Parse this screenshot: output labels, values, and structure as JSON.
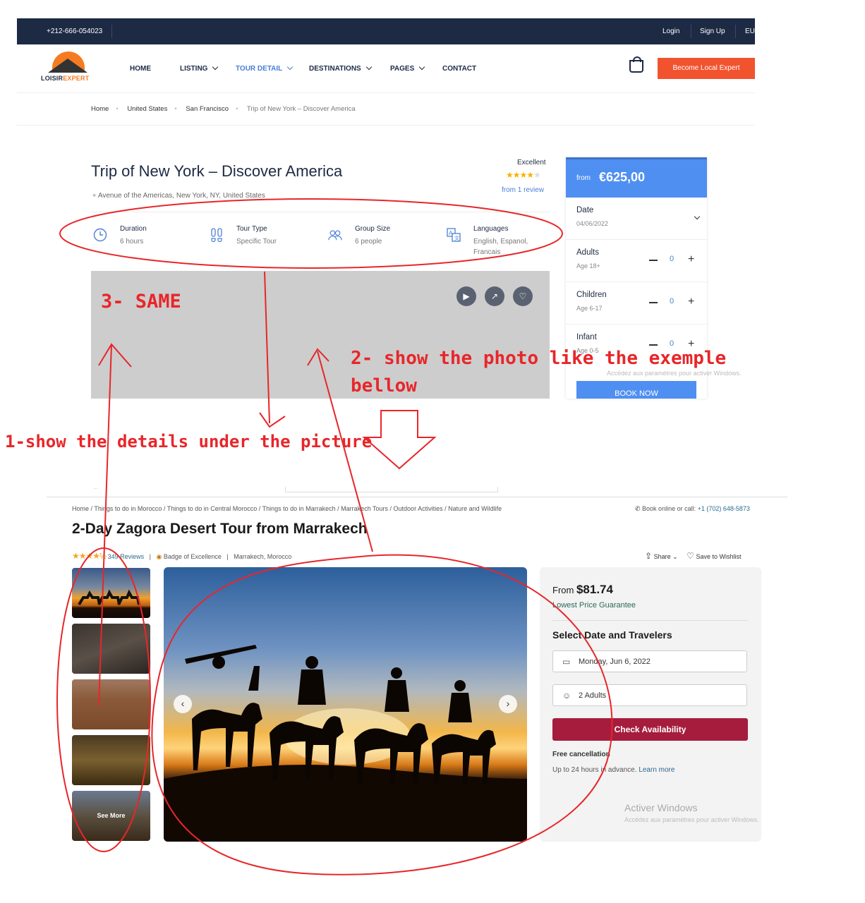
{
  "topbar": {
    "phone": "+212-666-054023",
    "login": "Login",
    "signup": "Sign Up",
    "currency": "EU"
  },
  "logo": {
    "part1": "LOISIR",
    "part2": "EXPERT"
  },
  "nav": {
    "items": [
      "HOME",
      "LISTING",
      "TOUR DETAIL",
      "DESTINATIONS",
      "PAGES",
      "CONTACT"
    ],
    "become_expert": "Become Local Expert"
  },
  "breadcrumb": [
    "Home",
    "United States",
    "San Francisco",
    "Trip of New York – Discover America"
  ],
  "tour": {
    "title": "Trip of New York – Discover America",
    "address": "Avenue of the Americas, New York, NY, United States",
    "rating_label": "Excellent",
    "rating_stars": 4,
    "reviews": "from 1 review",
    "features": [
      {
        "label": "Duration",
        "value": "6 hours",
        "icon": "clock-icon"
      },
      {
        "label": "Tour Type",
        "value": "Specific Tour",
        "icon": "footprints-icon"
      },
      {
        "label": "Group Size",
        "value": "6 people",
        "icon": "people-icon"
      },
      {
        "label": "Languages",
        "value": "English, Espanol, Francais",
        "icon": "translate-icon"
      }
    ]
  },
  "booking": {
    "from": "from",
    "price": "€625,00",
    "date_label": "Date",
    "date_value": "04/06/2022",
    "rows": [
      {
        "label": "Adults",
        "sub": "Age 18+",
        "count": "0"
      },
      {
        "label": "Children",
        "sub": "Age 6-17",
        "count": "0"
      },
      {
        "label": "Infant",
        "sub": "Age 0-5",
        "count": "0"
      }
    ],
    "book_now": "BOOK NOW"
  },
  "watermark": {
    "title": "Activer Windows",
    "sub": "Accédez aux paramètres pour activer Windows."
  },
  "annotations": {
    "a1": "1-show the details under the picture",
    "a2_line1": "2- show the photo like the exemple",
    "a2_line2": "bellow",
    "a3": "3- SAME"
  },
  "example": {
    "breadcrumb": "Home / Things to do in Morocco / Things to do in Central Morocco / Things to do in Marrakech / Marrakech Tours / Outdoor Activities / Nature and Wildlife",
    "book_call_prefix": "Book online or call:",
    "book_call_number": "+1 (702) 648-5873",
    "title": "2-Day Zagora Desert Tour from Marrakech",
    "rating": 4.5,
    "reviews": "349 Reviews",
    "badge": "Badge of Excellence",
    "location": "Marrakech, Morocco",
    "share": "Share",
    "wishlist": "Save to Wishlist",
    "see_more": "See More",
    "from": "From",
    "price": "$81.74",
    "lowest_price": "Lowest Price Guarantee",
    "select_title": "Select Date and Travelers",
    "date_field": "Monday, Jun 6, 2022",
    "travelers_field": "2 Adults",
    "check_btn": "Check Availability",
    "free_cancel": "Free cancellation",
    "cancel_note": "Up to 24 hours in advance.",
    "learn_more": "Learn more"
  },
  "colors": {
    "topbar": "#1d2a44",
    "accent_blue": "#4f8ff2",
    "orange": "#f2532f",
    "annotation_red": "#e8262a",
    "check_btn": "#a61c3c"
  }
}
